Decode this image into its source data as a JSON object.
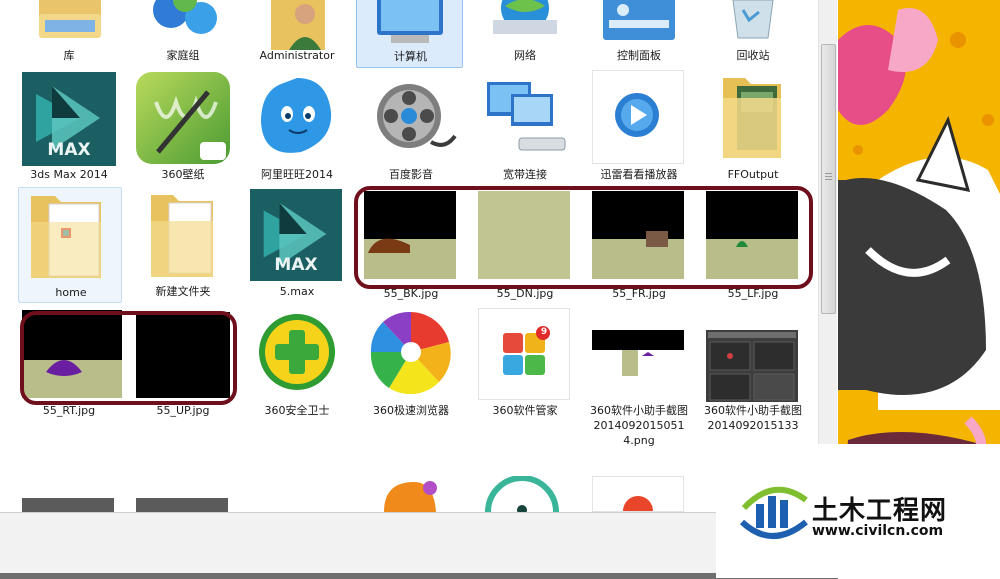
{
  "row0": [
    "库",
    "家庭组",
    "Administrator",
    "计算机",
    "网络",
    "控制面板",
    "回收站"
  ],
  "row1": [
    "3ds Max 2014",
    "360壁纸",
    "阿里旺旺2014",
    "百度影音",
    "宽带连接",
    "迅雷看看播放器",
    "FFOutput"
  ],
  "row2": [
    "home",
    "新建文件夹",
    "5.max",
    "55_BK.jpg",
    "55_DN.jpg",
    "55_FR.jpg",
    "55_LF.jpg"
  ],
  "row3": [
    "55_RT.jpg",
    "55_UP.jpg",
    "360安全卫士",
    "360极速浏览器",
    "360软件管家",
    "360软件小助手截图2014092015051 4.png",
    "360软件小助手截图201409201513​3"
  ],
  "icon_text": {
    "max": "MAX",
    "badge": "9"
  },
  "watermark": {
    "cn": "土木工程网",
    "url": "www.civilcn.com"
  }
}
